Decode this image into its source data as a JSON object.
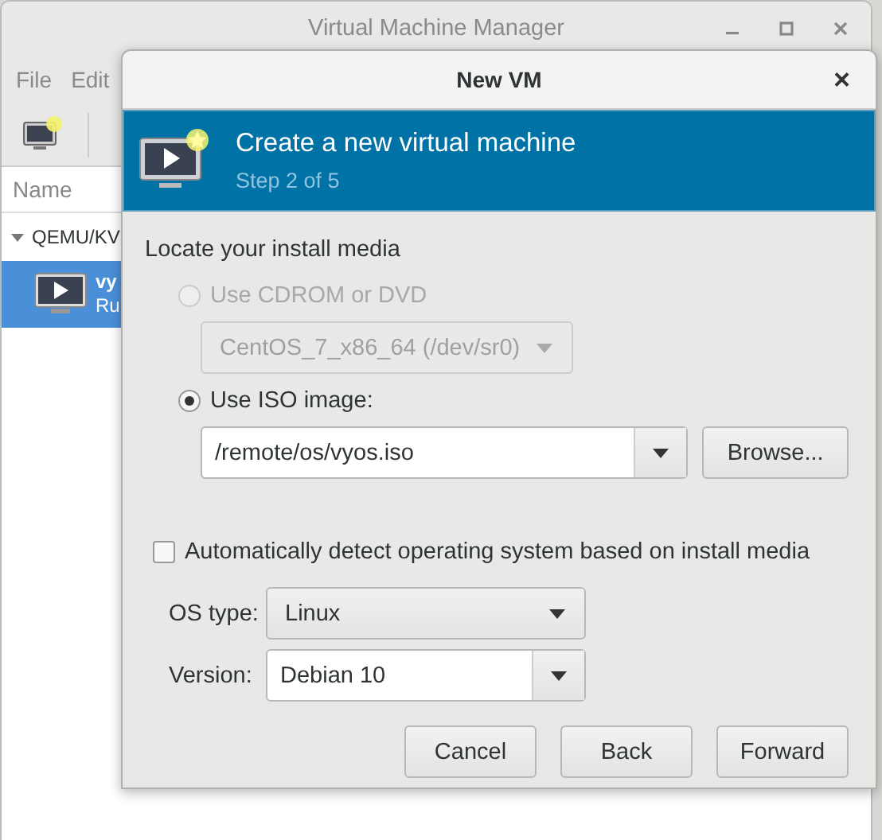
{
  "main_window": {
    "title": "Virtual Machine Manager",
    "menu": [
      "File",
      "Edit"
    ],
    "column_header": "Name",
    "tree": [
      {
        "label": "QEMU/KV",
        "expanded": true,
        "children": [
          {
            "name": "vy",
            "status": "Ru",
            "selected": true
          }
        ]
      }
    ]
  },
  "dialog": {
    "title": "New VM",
    "close": "×",
    "banner": {
      "title": "Create a new virtual machine",
      "subtitle": "Step 2 of 5"
    },
    "section_label": "Locate your install media",
    "media_options": [
      {
        "kind": "cdrom",
        "label": "Use CDROM or DVD",
        "selected": false,
        "disabled": true,
        "value": "CentOS_7_x86_64 (/dev/sr0)"
      },
      {
        "kind": "iso",
        "label": "Use ISO image:",
        "selected": true,
        "disabled": false,
        "value": "/remote/os/vyos.iso",
        "browse": "Browse..."
      }
    ],
    "auto_detect": {
      "label": "Automatically detect operating system based on install media",
      "checked": false
    },
    "os_type": {
      "label": "OS type:",
      "value": "Linux"
    },
    "version": {
      "label": "Version:",
      "value": "Debian 10"
    },
    "buttons": [
      "Cancel",
      "Back",
      "Forward"
    ]
  }
}
